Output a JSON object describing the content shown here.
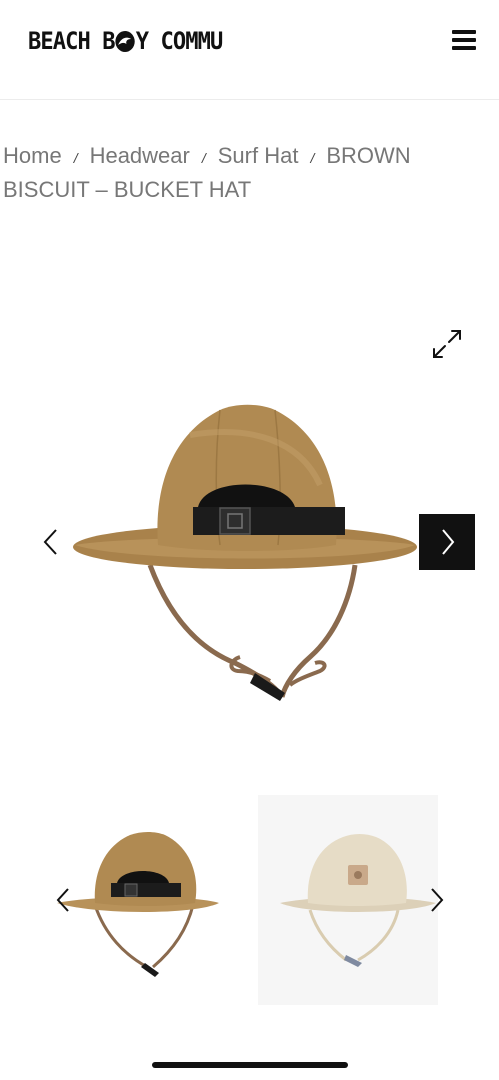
{
  "header": {
    "logo_part1": "BEACH B",
    "logo_part2": "Y COMMU",
    "menu_icon": "hamburger-menu-icon"
  },
  "breadcrumb": {
    "items": [
      "Home",
      "Headwear",
      "Surf Hat"
    ],
    "separator": "/",
    "current": "BROWN BISCUIT – BUCKET HAT"
  },
  "gallery": {
    "expand_icon": "expand-icon",
    "prev_icon": "chevron-left-icon",
    "next_icon": "chevron-right-icon",
    "main_image": "brown-bucket-hat-back-view",
    "hat_color": "#b08a52",
    "strap_color": "#8a6a4e",
    "next_button_color": "#111111"
  },
  "thumbnails": {
    "items": [
      "brown-bucket-hat-back-view",
      "beige-bucket-hat-front-view"
    ],
    "thumb2_color": "#e6dcc6"
  }
}
